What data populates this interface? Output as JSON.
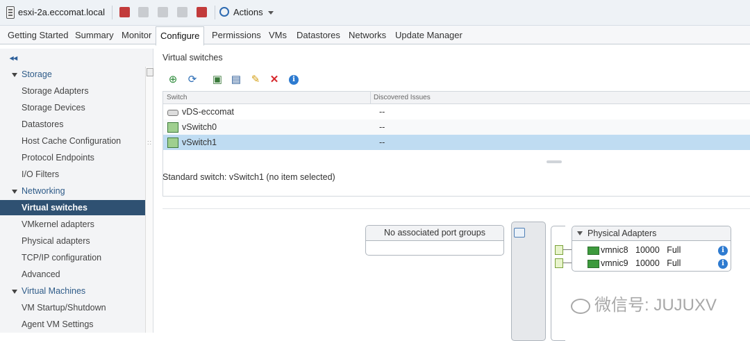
{
  "header": {
    "host_title": "esxi-2a.eccomat.local",
    "actions_label": "Actions"
  },
  "tabs": [
    {
      "label": "Getting Started"
    },
    {
      "label": "Summary"
    },
    {
      "label": "Monitor"
    },
    {
      "label": "Configure"
    },
    {
      "label": "Permissions"
    },
    {
      "label": "VMs"
    },
    {
      "label": "Datastores"
    },
    {
      "label": "Networks"
    },
    {
      "label": "Update Manager"
    }
  ],
  "active_tab": "Configure",
  "sidebar": {
    "collapse_glyph": "◂◂",
    "items": [
      {
        "label": "Storage",
        "group": true
      },
      {
        "label": "Storage Adapters"
      },
      {
        "label": "Storage Devices"
      },
      {
        "label": "Datastores"
      },
      {
        "label": "Host Cache Configuration"
      },
      {
        "label": "Protocol Endpoints"
      },
      {
        "label": "I/O Filters"
      },
      {
        "label": "Networking",
        "group": true
      },
      {
        "label": "Virtual switches",
        "selected": true
      },
      {
        "label": "VMkernel adapters"
      },
      {
        "label": "Physical adapters"
      },
      {
        "label": "TCP/IP configuration"
      },
      {
        "label": "Advanced"
      },
      {
        "label": "Virtual Machines",
        "group": true
      },
      {
        "label": "VM Startup/Shutdown"
      },
      {
        "label": "Agent VM Settings"
      }
    ]
  },
  "main": {
    "section_title": "Virtual switches",
    "grid": {
      "columns": [
        "Switch",
        "Discovered Issues"
      ],
      "rows": [
        {
          "switch": "vDS-eccomat",
          "issues": "--",
          "icon": "distributed-switch-icon"
        },
        {
          "switch": "vSwitch0",
          "issues": "--",
          "icon": "standard-switch-icon"
        },
        {
          "switch": "vSwitch1",
          "issues": "--",
          "icon": "standard-switch-icon",
          "selected": true
        }
      ]
    },
    "detail_title": "Standard switch: vSwitch1 (no item selected)",
    "diagram": {
      "port_groups_label": "No associated port groups",
      "physical_adapters_label": "Physical Adapters",
      "adapters": [
        {
          "name": "vmnic8",
          "speed": "10000",
          "duplex": "Full"
        },
        {
          "name": "vmnic9",
          "speed": "10000",
          "duplex": "Full"
        }
      ]
    }
  },
  "watermark": "微信号: JUJUXV",
  "colors": {
    "selected_nav_bg": "#2f5172",
    "selected_row_bg": "#bfdcf2",
    "info_blue": "#2e7bd0",
    "delete_red": "#d6262b"
  }
}
